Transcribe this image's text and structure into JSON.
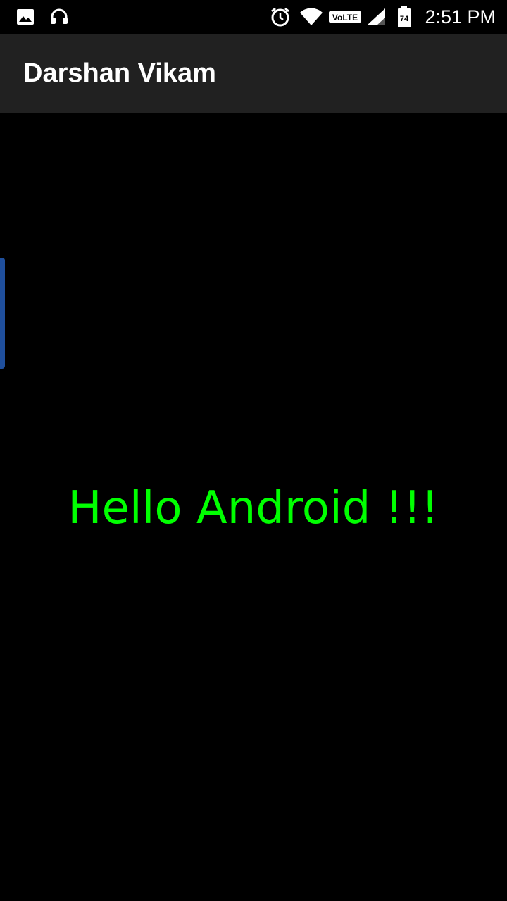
{
  "status_bar": {
    "time": "2:51 PM",
    "volte_label": "VoLTE",
    "battery_level": "74",
    "left_icons": [
      "gallery-icon",
      "headset-icon"
    ],
    "right_icons": [
      "alarm-icon",
      "wifi-icon",
      "volte-icon",
      "signal-icon",
      "battery-icon"
    ]
  },
  "app_bar": {
    "title": "Darshan Vikam",
    "background": "#212121"
  },
  "main": {
    "message": "Hello Android !!!",
    "message_color": "#00ff00",
    "background": "#000000"
  },
  "edge_handle": {
    "color": "#1f4f9c"
  }
}
